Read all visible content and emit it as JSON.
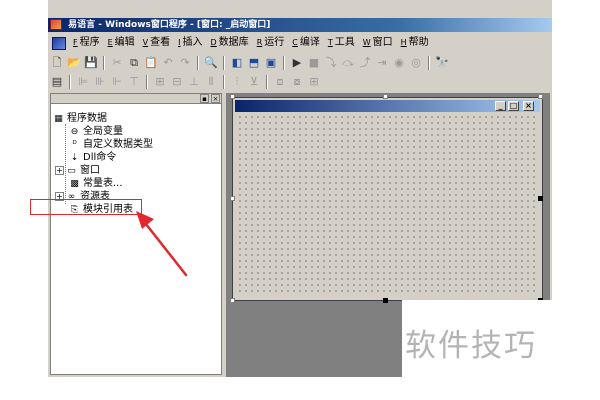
{
  "window": {
    "title": "易语言 - Windows窗口程序 - [窗口: _启动窗口]"
  },
  "menu": {
    "items": [
      {
        "key": "F",
        "label": "程序"
      },
      {
        "key": "E",
        "label": "编辑"
      },
      {
        "key": "V",
        "label": "查看"
      },
      {
        "key": "I",
        "label": "插入"
      },
      {
        "key": "D",
        "label": "数据库"
      },
      {
        "key": "R",
        "label": "运行"
      },
      {
        "key": "C",
        "label": "编译"
      },
      {
        "key": "T",
        "label": "工具"
      },
      {
        "key": "W",
        "label": "窗口"
      },
      {
        "key": "H",
        "label": "帮助"
      }
    ]
  },
  "panel": {
    "minimize_glyph": "▪",
    "close_glyph": "×"
  },
  "tree": {
    "root": "程序数据",
    "items": [
      {
        "label": "全局变量",
        "icon": "globe-icon"
      },
      {
        "label": "自定义数据类型",
        "icon": "datatype-icon"
      },
      {
        "label": "Dll命令",
        "icon": "dll-icon"
      },
      {
        "label": "窗口",
        "icon": "window-icon"
      },
      {
        "label": "常量表...",
        "icon": "constant-icon"
      },
      {
        "label": "资源表",
        "icon": "resource-icon"
      },
      {
        "label": "模块引用表",
        "icon": "module-icon"
      }
    ]
  },
  "form": {
    "minimize_glyph": "_",
    "maximize_glyph": "□",
    "close_glyph": "×"
  },
  "watermark": {
    "text": "软件技巧"
  },
  "colors": {
    "title_gradient_start": "#0a246a",
    "title_gradient_end": "#a6caf0",
    "highlight_border": "#e0282e",
    "face": "#d4d0c8"
  }
}
